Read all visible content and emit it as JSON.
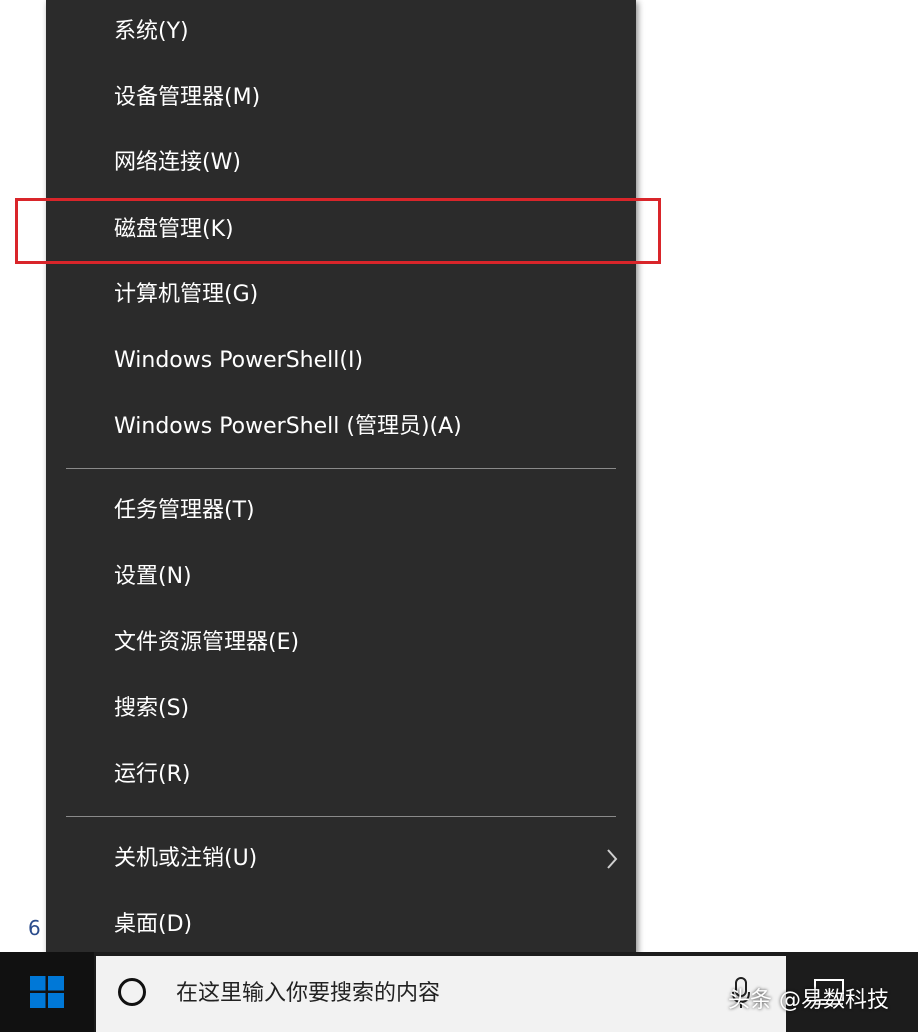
{
  "background": {
    "fragment_text": "6"
  },
  "menu": {
    "items": [
      {
        "label": "系统(Y)"
      },
      {
        "label": "设备管理器(M)"
      },
      {
        "label": "网络连接(W)"
      },
      {
        "label": "磁盘管理(K)"
      },
      {
        "label": "计算机管理(G)"
      },
      {
        "label": "Windows PowerShell(I)"
      },
      {
        "label": "Windows PowerShell (管理员)(A)"
      },
      {
        "label": "任务管理器(T)"
      },
      {
        "label": "设置(N)"
      },
      {
        "label": "文件资源管理器(E)"
      },
      {
        "label": "搜索(S)"
      },
      {
        "label": "运行(R)"
      },
      {
        "label": "关机或注销(U)"
      },
      {
        "label": "桌面(D)"
      }
    ],
    "highlighted_item": "磁盘管理(K)",
    "highlight_color": "#d9252a",
    "background_color": "#2b2b2b",
    "submenu_arrow_icon": "chevron-right-icon"
  },
  "taskbar": {
    "start_icon": "windows-logo-icon",
    "search": {
      "icon": "cortana-circle-icon",
      "placeholder": "在这里输入你要搜索的内容"
    },
    "accent_color": "#0078d7"
  },
  "watermark": {
    "text": "头条 @易数科技"
  }
}
